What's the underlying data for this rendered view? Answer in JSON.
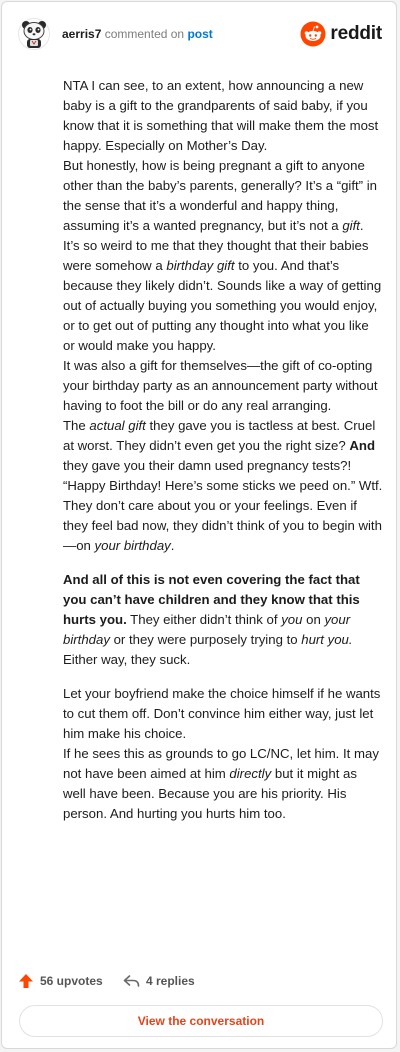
{
  "header": {
    "username": "aerris7",
    "action": "commented on",
    "post_link": "post",
    "brand": "reddit"
  },
  "comment": {
    "p1_l1": "NTA I can see, to an extent, how announcing a new baby is a gift to the grandparents of said baby, if you know that it is something that will make them the most happy. Especially on Mother’s Day.",
    "p1_l2a": "But honestly, how is being pregnant a gift to anyone other than the baby’s parents, generally? It’s a “gift” in the sense that it’s a wonderful and happy thing, assuming it’s a wanted pregnancy, but it’s not a ",
    "p1_l2b": "gift",
    "p1_l2c": ". It’s so weird to me that they thought that their babies were somehow a ",
    "p1_l2d": "birthday gift",
    "p1_l2e": " to you. And that’s because they likely didn’t. Sounds like a way of getting out of actually buying you something you would enjoy, or to get out of putting any thought into what you like or would make you happy.",
    "p1_l3": "It was also a gift for themselves—the gift of co-opting your birthday party as an announcement party without having to foot the bill or do any real arranging.",
    "p1_l4a": "The ",
    "p1_l4b": "actual gift",
    "p1_l4c": " they gave you is tactless at best. Cruel at worst. They didn’t even get you the right size? ",
    "p1_l4d": "And",
    "p1_l4e": " they gave you their damn used pregnancy tests?! “Happy Birthday! Here’s some sticks we peed on.” Wtf.",
    "p1_l5a": "They don’t care about you or your feelings. Even if they feel bad now, they didn’t think of you to begin with—on ",
    "p1_l5b": "your birthday",
    "p1_l5c": ".",
    "p2a": "And all of this is not even covering the fact that you can’t have children and they know that this hurts you.",
    "p2b": " They either didn’t think of ",
    "p2c": "you",
    "p2d": " on ",
    "p2e": "your birthday",
    "p2f": " or they were purposely trying to ",
    "p2g": "hurt you.",
    "p2h": " Either way, they suck.",
    "p3_l1": "Let your boyfriend make the choice himself if he wants to cut them off. Don’t convince him either way, just let him make his choice.",
    "p3_l2a": "If he sees this as grounds to go LC/NC, let him. It may not have been aimed at him ",
    "p3_l2b": "directly",
    "p3_l2c": " but it might as well have been. Because you are his priority. His person. And hurting you hurts him too."
  },
  "footer": {
    "upvotes": "56 upvotes",
    "replies": "4 replies",
    "view_conversation": "View the conversation"
  },
  "colors": {
    "brand_orange": "#ff4500",
    "upvote_orange": "#ff4500",
    "link_blue": "#0079d3",
    "button_text": "#e4441b"
  },
  "icons": {
    "avatar": "panda-avatar",
    "brand": "reddit-snoo-icon",
    "upvote": "upvote-arrow-icon",
    "reply": "reply-arrow-icon"
  }
}
